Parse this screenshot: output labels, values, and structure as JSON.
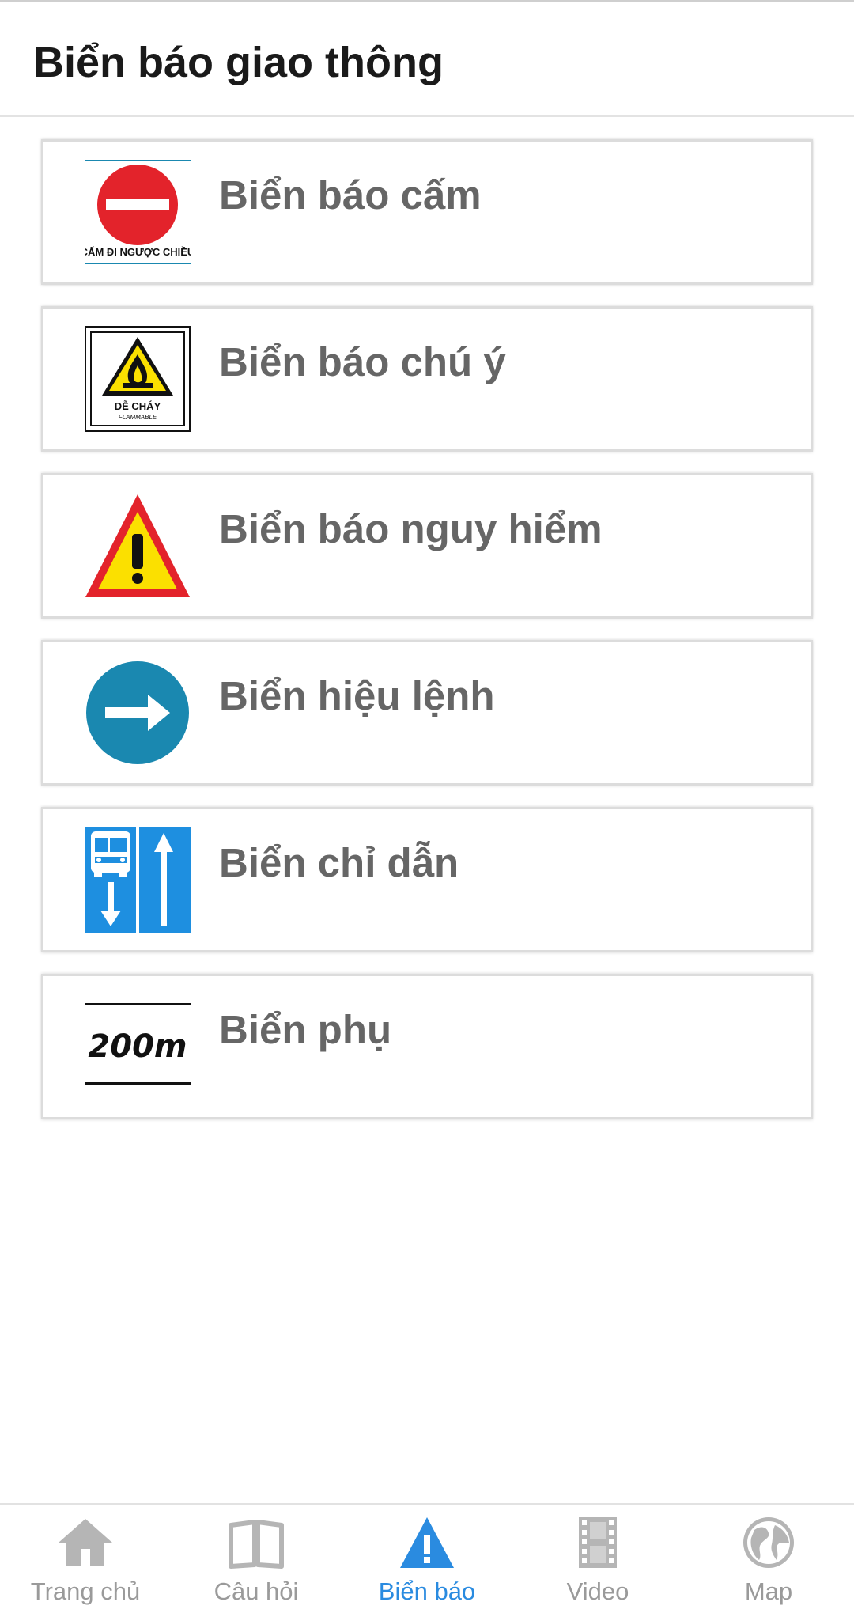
{
  "header": {
    "title": "Biển báo giao thông"
  },
  "categories": [
    {
      "label": "Biển báo cấm",
      "icon": "no-entry-sign-icon",
      "sign_caption": "CẤM ĐI NGƯỢC CHIỀU"
    },
    {
      "label": "Biển báo chú ý",
      "icon": "flammable-warning-sign-icon",
      "sign_caption": "DỄ CHÁY",
      "sign_subcaption": "FLAMMABLE"
    },
    {
      "label": "Biển báo nguy hiểm",
      "icon": "danger-triangle-sign-icon"
    },
    {
      "label": "Biển hiệu lệnh",
      "icon": "right-arrow-mandatory-sign-icon"
    },
    {
      "label": "Biển chỉ dẫn",
      "icon": "bus-lane-guide-sign-icon"
    },
    {
      "label": "Biển phụ",
      "icon": "distance-200m-sign-icon",
      "sign_caption": "200m"
    }
  ],
  "bottom_nav": {
    "items": [
      {
        "label": "Trang chủ",
        "icon": "home-icon",
        "active": false
      },
      {
        "label": "Câu hỏi",
        "icon": "book-icon",
        "active": false
      },
      {
        "label": "Biển báo",
        "icon": "warning-sign-icon",
        "active": true
      },
      {
        "label": "Video",
        "icon": "film-icon",
        "active": false
      },
      {
        "label": "Map",
        "icon": "globe-icon",
        "active": false
      }
    ]
  },
  "colors": {
    "accent": "#2a8be0",
    "inactive": "#9a9a9a",
    "card_text": "#666666",
    "sign_red": "#e3232b",
    "sign_yellow": "#fbe000",
    "sign_blue_round": "#1a88b0",
    "sign_blue_guide": "#1e8fe0"
  }
}
